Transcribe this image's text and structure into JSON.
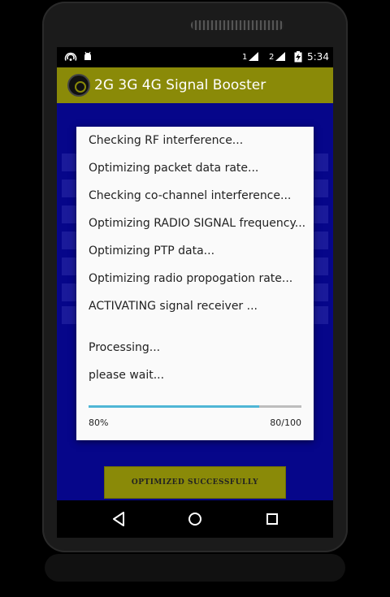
{
  "status_bar": {
    "time": "5:34",
    "sim1_label": "1",
    "sim2_label": "2",
    "left_icons": [
      "wifi-hotspot-icon",
      "android-debug-icon"
    ]
  },
  "app": {
    "title": "2G 3G 4G Signal Booster"
  },
  "dialog": {
    "lines": [
      "Checking RF interference...",
      "Optimizing packet data rate...",
      "Checking co-channel interference...",
      "Optimizing RADIO SIGNAL frequency...",
      "Optimizing PTP data...",
      "Optimizing radio propogation rate...",
      "ACTIVATING signal receiver ..."
    ],
    "processing": "Processing...",
    "please_wait": "please wait...",
    "progress_percent": "80%",
    "progress_count": "80/100",
    "progress_fraction": 0.8
  },
  "main_button": {
    "label": "OPTIMIZED SUCCESSFULLY"
  },
  "nav": {
    "icons": [
      "back-icon",
      "home-icon",
      "recents-icon"
    ]
  },
  "colors": {
    "background_blue": "#06068a",
    "app_bar": "#8a8a08",
    "progress": "#4fb6d6"
  }
}
